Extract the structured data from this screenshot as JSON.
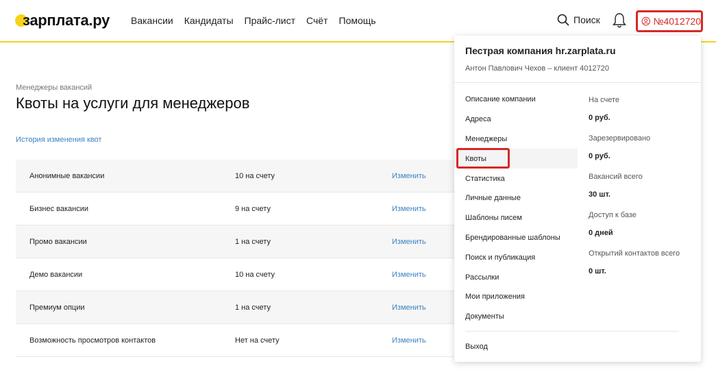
{
  "brand": {
    "name": "зарплата.ру",
    "accent": "#f7d21a"
  },
  "nav": [
    "Вакансии",
    "Кандидаты",
    "Прайс-лист",
    "Счёт",
    "Помощь"
  ],
  "search": {
    "label": "Поиск",
    "icon": "search-icon"
  },
  "account": {
    "number": "№4012720",
    "highlight": "#d62828"
  },
  "page": {
    "breadcrumb": "Менеджеры вакансий",
    "title": "Квоты на услуги для менеджеров",
    "history_link": "История изменения квот"
  },
  "quotas": [
    {
      "name": "Анонимные вакансии",
      "count": "10 на счету",
      "action": "Изменить"
    },
    {
      "name": "Бизнес вакансии",
      "count": "9 на счету",
      "action": "Изменить"
    },
    {
      "name": "Промо вакансии",
      "count": "1 на счету",
      "action": "Изменить"
    },
    {
      "name": "Демо вакансии",
      "count": "10 на счету",
      "action": "Изменить"
    },
    {
      "name": "Премиум опции",
      "count": "1 на счету",
      "action": "Изменить"
    },
    {
      "name": "Возможность просмотров контактов",
      "count": "Нет на счету",
      "action": "Изменить"
    }
  ],
  "dropdown": {
    "company": "Пестрая компания hr.zarplata.ru",
    "user": "Антон Павлович Чехов – клиент 4012720",
    "menu": [
      "Описание компании",
      "Адреса",
      "Менеджеры",
      "Квоты",
      "Статистика",
      "Личные данные",
      "Шаблоны писем",
      "Брендированные шаблоны",
      "Поиск и публикация",
      "Рассылки",
      "Мои приложения",
      "Документы"
    ],
    "stats": [
      {
        "label": "На счете",
        "value": "0 руб."
      },
      {
        "label": "Зарезервировано",
        "value": "0 руб."
      },
      {
        "label": "Вакансий всего",
        "value": "30 шт."
      },
      {
        "label": "Доступ к базе",
        "value": "0 дней"
      },
      {
        "label": "Открытий контактов всего",
        "value": "0 шт."
      }
    ],
    "logout": "Выход"
  }
}
